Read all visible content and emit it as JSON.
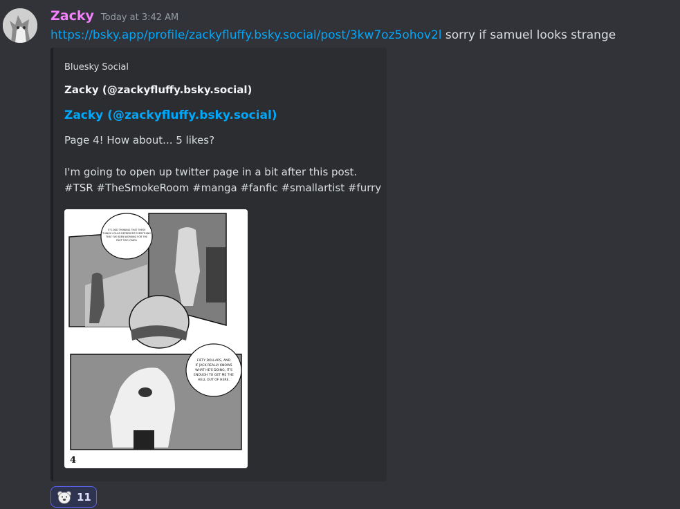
{
  "message": {
    "author": "Zacky",
    "timestamp": "Today at 3:42 AM",
    "link_text": "https://bsky.app/profile/zackyfluffy.bsky.social/post/3kw7oz5ohov2l",
    "text": " sorry if samuel looks strange"
  },
  "embed": {
    "provider": "Bluesky Social",
    "author": "Zacky (@zackyfluffy.bsky.social)",
    "title": "Zacky (@zackyfluffy.bsky.social)",
    "description_lines": [
      "Page 4! How about... 5 likes?",
      "",
      "I'm going to open up twitter page in a bit after this post.",
      "#TSR #TheSmokeRoom #manga #fanfic #smallartist #furry"
    ],
    "image": {
      "bubble_1": [
        "IT'S ODD THINKING THAT THESE",
        "THINGS COULD REPRESENT EVERYTHING",
        "THAT I'VE BEEN WORKING FOR THE",
        "PAST TWO YEARS"
      ],
      "bubble_2": [
        "FIFTY DOLLARS, AND",
        "IF JACK REALLY KNOWS",
        "WHAT HE'S DOING, IT'S",
        "ENOUGH TO GET ME THE",
        "HELL OUT OF HERE."
      ],
      "page_number": "4"
    }
  },
  "reaction": {
    "emoji": "bear-face-icon",
    "count": "11"
  },
  "colors": {
    "background": "#313338",
    "username": "#f47fff",
    "link": "#00a8fc",
    "embed_bg": "#2b2d31",
    "reaction_border": "#5865f2"
  }
}
